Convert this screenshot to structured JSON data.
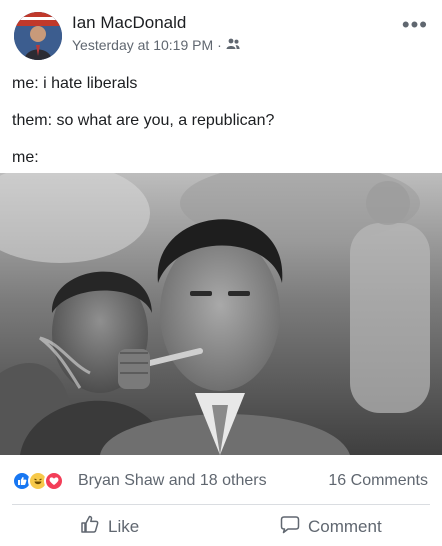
{
  "post": {
    "author": "Ian MacDonald",
    "timestamp": "Yesterday at 10:19 PM",
    "separator": "·",
    "privacy_icon": "friends-icon",
    "lines": [
      "me: i hate liberals",
      "them: so what are you, a republican?",
      "me:"
    ]
  },
  "reactions": {
    "icons": [
      "like-icon",
      "haha-icon",
      "love-icon"
    ],
    "reactors": "Bryan Shaw and 18 others",
    "comments": "16 Comments"
  },
  "actions": {
    "like": "Like",
    "comment": "Comment"
  },
  "colors": {
    "like_blue": "#1877f2",
    "haha_yellow": "#f7c94a",
    "love_red": "#f33e58",
    "secondary_text": "#606770"
  }
}
